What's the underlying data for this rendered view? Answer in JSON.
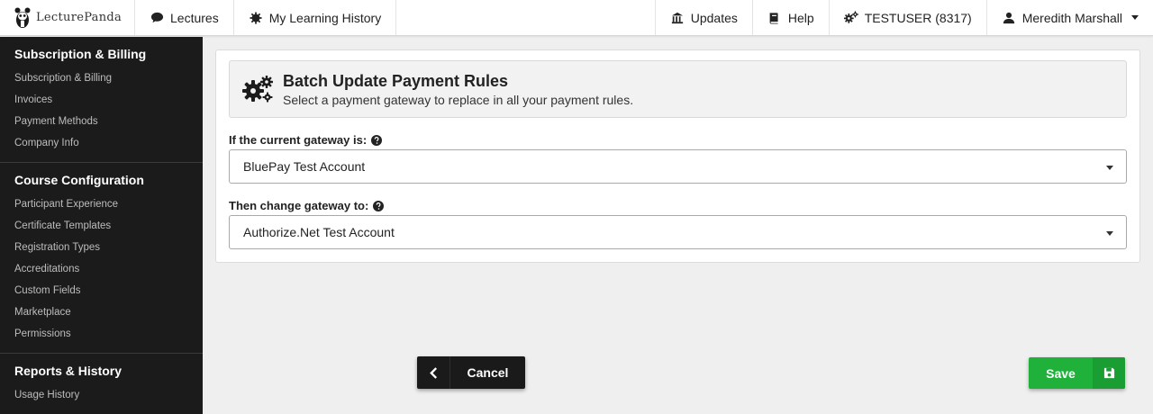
{
  "brand": {
    "name": "LecturePanda"
  },
  "topnav": {
    "lectures": "Lectures",
    "history": "My Learning History",
    "updates": "Updates",
    "help": "Help",
    "account": "TESTUSER (8317)",
    "user": "Meredith Marshall"
  },
  "sidebar": {
    "sections": [
      {
        "title": "Subscription & Billing",
        "items": [
          "Subscription & Billing",
          "Invoices",
          "Payment Methods",
          "Company Info"
        ]
      },
      {
        "title": "Course Configuration",
        "items": [
          "Participant Experience",
          "Certificate Templates",
          "Registration Types",
          "Accreditations",
          "Custom Fields",
          "Marketplace",
          "Permissions"
        ]
      },
      {
        "title": "Reports & History",
        "items": [
          "Usage History"
        ]
      }
    ]
  },
  "main": {
    "title": "Batch Update Payment Rules",
    "subtitle": "Select a payment gateway to replace in all your payment rules.",
    "current_label": "If the current gateway is:",
    "current_value": "BluePay Test Account",
    "change_label": "Then change gateway to:",
    "change_value": "Authorize.Net Test Account"
  },
  "buttons": {
    "cancel": "Cancel",
    "save": "Save"
  },
  "colors": {
    "sidebar_bg": "#1b1b1b",
    "save_green": "#1fb13a",
    "cancel_dark": "#1a1a1a"
  },
  "icons": [
    "panda-logo-icon",
    "comment-icon",
    "gear-icon",
    "updates-icon",
    "book-icon",
    "gears-icon",
    "user-icon",
    "question-circle-icon",
    "chevron-left-icon",
    "floppy-disk-icon"
  ]
}
